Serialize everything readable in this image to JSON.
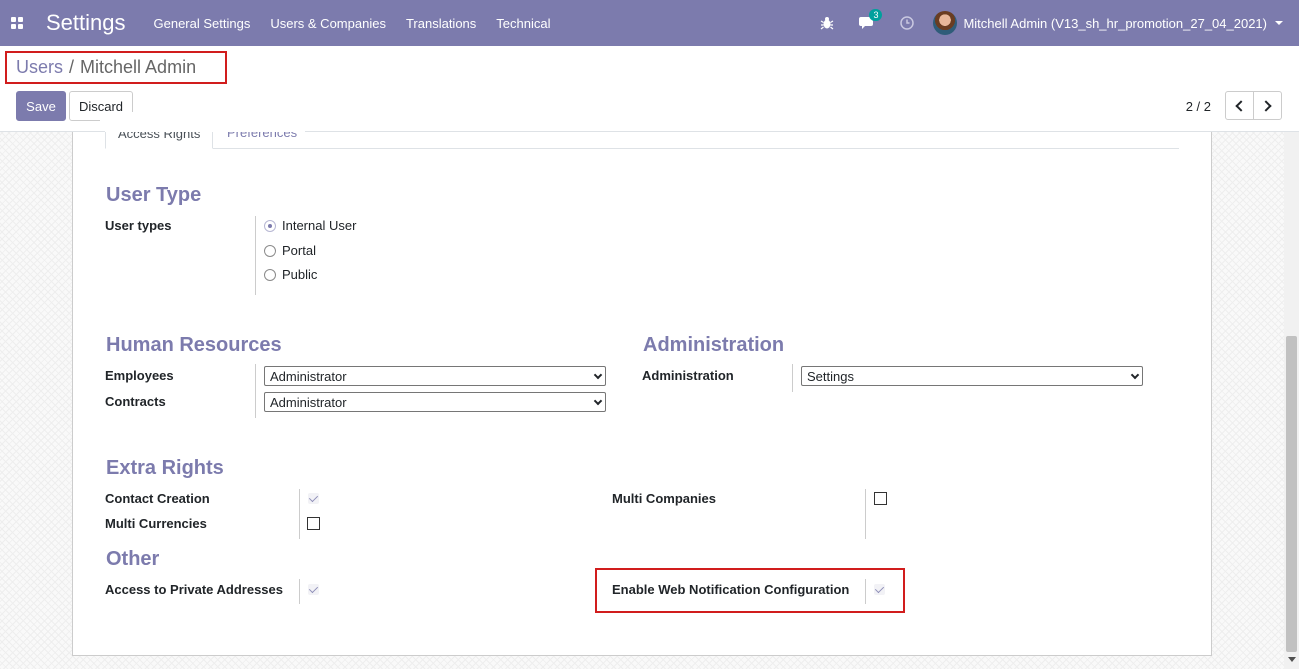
{
  "navbar": {
    "app_title": "Settings",
    "menu": [
      "General Settings",
      "Users & Companies",
      "Translations",
      "Technical"
    ],
    "chat_count": "3",
    "user_name": "Mitchell Admin (V13_sh_hr_promotion_27_04_2021)"
  },
  "breadcrumb": {
    "parent": "Users",
    "separator": "/",
    "current": "Mitchell Admin"
  },
  "buttons": {
    "save": "Save",
    "discard": "Discard"
  },
  "pager": {
    "value": "2 / 2"
  },
  "tabs": {
    "active": "Access Rights",
    "inactive": "Preferences"
  },
  "user_type": {
    "title": "User Type",
    "label": "User types",
    "options": [
      "Internal User",
      "Portal",
      "Public"
    ],
    "selected": "Internal User"
  },
  "human_resources": {
    "title": "Human Resources",
    "employees_label": "Employees",
    "employees_value": "Administrator",
    "contracts_label": "Contracts",
    "contracts_value": "Administrator"
  },
  "administration": {
    "title": "Administration",
    "label": "Administration",
    "value": "Settings"
  },
  "extra_rights": {
    "title": "Extra Rights",
    "contact_creation": "Contact Creation",
    "multi_currencies": "Multi Currencies",
    "multi_companies": "Multi Companies"
  },
  "other": {
    "title": "Other",
    "private_addresses": "Access to Private Addresses",
    "web_notification": "Enable Web Notification Configuration"
  },
  "colors": {
    "brand": "#7c7bad",
    "highlight": "#d11d1d",
    "badge": "#00a09d"
  }
}
